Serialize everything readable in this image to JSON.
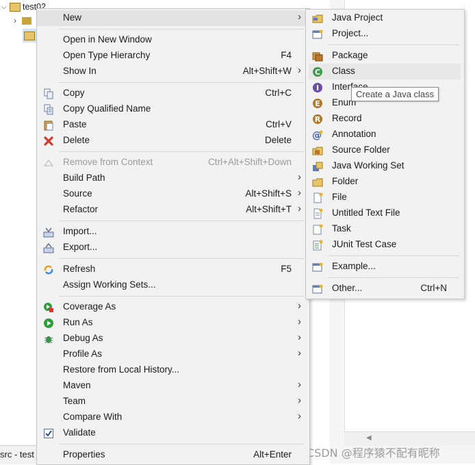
{
  "tree": {
    "project_name": "test02",
    "status_label": "src - test"
  },
  "context_menu": {
    "items": [
      {
        "label": "New",
        "accel": "",
        "submenu": true,
        "icon": ""
      },
      {
        "label": "Open in New Window",
        "accel": "",
        "icon": ""
      },
      {
        "label": "Open Type Hierarchy",
        "accel": "F4",
        "icon": ""
      },
      {
        "label": "Show In",
        "accel": "Alt+Shift+W",
        "submenu": true,
        "icon": ""
      },
      {
        "label": "Copy",
        "accel": "Ctrl+C",
        "icon": "copy-icon"
      },
      {
        "label": "Copy Qualified Name",
        "accel": "",
        "icon": "copy-qualified-name-icon"
      },
      {
        "label": "Paste",
        "accel": "Ctrl+V",
        "icon": "paste-icon"
      },
      {
        "label": "Delete",
        "accel": "Delete",
        "icon": "delete-icon"
      },
      {
        "label": "Remove from Context",
        "accel": "Ctrl+Alt+Shift+Down",
        "disabled": true,
        "icon": "remove-context-icon"
      },
      {
        "label": "Build Path",
        "accel": "",
        "submenu": true,
        "icon": ""
      },
      {
        "label": "Source",
        "accel": "Alt+Shift+S",
        "submenu": true,
        "icon": ""
      },
      {
        "label": "Refactor",
        "accel": "Alt+Shift+T",
        "submenu": true,
        "icon": ""
      },
      {
        "label": "Import...",
        "accel": "",
        "icon": "import-icon"
      },
      {
        "label": "Export...",
        "accel": "",
        "icon": "export-icon"
      },
      {
        "label": "Refresh",
        "accel": "F5",
        "icon": "refresh-icon"
      },
      {
        "label": "Assign Working Sets...",
        "accel": "",
        "icon": ""
      },
      {
        "label": "Coverage As",
        "accel": "",
        "submenu": true,
        "icon": "coverage-icon"
      },
      {
        "label": "Run As",
        "accel": "",
        "submenu": true,
        "icon": "run-icon"
      },
      {
        "label": "Debug As",
        "accel": "",
        "submenu": true,
        "icon": "debug-icon"
      },
      {
        "label": "Profile As",
        "accel": "",
        "submenu": true,
        "icon": ""
      },
      {
        "label": "Restore from Local History...",
        "accel": "",
        "icon": ""
      },
      {
        "label": "Maven",
        "accel": "",
        "submenu": true,
        "icon": ""
      },
      {
        "label": "Team",
        "accel": "",
        "submenu": true,
        "icon": ""
      },
      {
        "label": "Compare With",
        "accel": "",
        "submenu": true,
        "icon": ""
      },
      {
        "label": "Validate",
        "accel": "",
        "icon": "validate-icon"
      },
      {
        "label": "Properties",
        "accel": "Alt+Enter",
        "icon": ""
      }
    ]
  },
  "new_submenu": {
    "items": [
      {
        "label": "Java Project",
        "accel": "",
        "icon": "java-project-icon"
      },
      {
        "label": "Project...",
        "accel": "",
        "icon": "project-icon"
      },
      {
        "label": "Package",
        "accel": "",
        "icon": "package-icon"
      },
      {
        "label": "Class",
        "accel": "",
        "icon": "class-icon"
      },
      {
        "label": "Interface",
        "accel": "",
        "icon": "interface-icon"
      },
      {
        "label": "Enum",
        "accel": "",
        "icon": "enum-icon"
      },
      {
        "label": "Record",
        "accel": "",
        "icon": "record-icon"
      },
      {
        "label": "Annotation",
        "accel": "",
        "icon": "annotation-icon"
      },
      {
        "label": "Source Folder",
        "accel": "",
        "icon": "source-folder-icon"
      },
      {
        "label": "Java Working Set",
        "accel": "",
        "icon": "working-set-icon"
      },
      {
        "label": "Folder",
        "accel": "",
        "icon": "folder-icon"
      },
      {
        "label": "File",
        "accel": "",
        "icon": "file-icon"
      },
      {
        "label": "Untitled Text File",
        "accel": "",
        "icon": "text-file-icon"
      },
      {
        "label": "Task",
        "accel": "",
        "icon": "task-icon"
      },
      {
        "label": "JUnit Test Case",
        "accel": "",
        "icon": "junit-icon"
      },
      {
        "label": "Example...",
        "accel": "",
        "icon": "example-icon"
      },
      {
        "label": "Other...",
        "accel": "Ctrl+N",
        "icon": "other-icon"
      }
    ]
  },
  "tooltip": {
    "text": "Create a Java class"
  },
  "watermark": {
    "text": "CSDN @程序猿不配有昵称"
  }
}
